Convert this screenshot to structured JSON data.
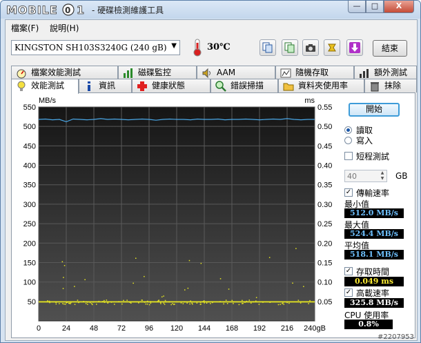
{
  "window": {
    "logo_text": "MOBILE01",
    "title": "- 硬碟檢測維護工具",
    "min_glyph": "—",
    "max_glyph": "□",
    "close_glyph": "X"
  },
  "menu": {
    "file": "檔案(F)",
    "help": "說明(H)"
  },
  "toolbar": {
    "drive": "KINGSTON SH103S3240G (240 gB)",
    "temperature": "30℃",
    "exit": "結束"
  },
  "tabs_top": [
    {
      "label": "檔案效能測試",
      "icon": "gauge-icon"
    },
    {
      "label": "磁碟監控",
      "icon": "bar-chart-icon"
    },
    {
      "label": "AAM",
      "icon": "speaker-icon"
    },
    {
      "label": "隨機存取",
      "icon": "random-access-icon"
    },
    {
      "label": "額外測試",
      "icon": "extra-chart-icon"
    }
  ],
  "tabs_bottom": [
    {
      "label": "效能測試",
      "icon": "bulb-icon"
    },
    {
      "label": "資訊",
      "icon": "info-icon"
    },
    {
      "label": "健康狀態",
      "icon": "red-cross-icon"
    },
    {
      "label": "錯誤掃描",
      "icon": "magnifier-icon"
    },
    {
      "label": "資料夾使用率",
      "icon": "folder-icon"
    },
    {
      "label": "抹除",
      "icon": "trash-icon"
    }
  ],
  "controls": {
    "start": "開始",
    "read": "讀取",
    "write": "寫入",
    "short_test": "短程測試",
    "size_value": "40",
    "size_unit": "GB",
    "transfer_rate": "傳輸速率",
    "min_label": "最小值",
    "min_value": "512.0 MB/s",
    "max_label": "最大值",
    "max_value": "524.4 MB/s",
    "avg_label": "平均值",
    "avg_value": "518.1 MB/s",
    "access_time": "存取時間",
    "access_value": "0.049 ms",
    "burst_rate": "高載速率",
    "burst_value": "325.8 MB/s",
    "cpu_label": "CPU 使用率",
    "cpu_value": "0.8%",
    "read_selected": true,
    "short_test_checked": false,
    "transfer_checked": true,
    "access_checked": true,
    "burst_checked": true
  },
  "chart_data": {
    "type": "line",
    "ylabel_left": "MB/s",
    "ylabel_right": "ms",
    "y_left_ticks": [
      "550",
      "500",
      "450",
      "400",
      "350",
      "300",
      "250",
      "200",
      "150",
      "100",
      "50"
    ],
    "y_right_ticks": [
      "0.55",
      "0.50",
      "0.45",
      "0.40",
      "0.35",
      "0.30",
      "0.25",
      "0.20",
      "0.15",
      "0.10",
      "0.05"
    ],
    "x_ticks": [
      "0",
      "24",
      "48",
      "72",
      "96",
      "120",
      "144",
      "168",
      "192",
      "216",
      "240gB"
    ],
    "ylim": [
      0,
      550
    ],
    "xlim": [
      0,
      240
    ],
    "grid": true,
    "series": [
      {
        "color": "#4aa8e8",
        "values_mbps": [
          518,
          519,
          517,
          518,
          512,
          519,
          518,
          517,
          518,
          520,
          518,
          519,
          518,
          517,
          518,
          519,
          518,
          516,
          518,
          519,
          518,
          518,
          517,
          519,
          518,
          518,
          519,
          517,
          518,
          518,
          519,
          518,
          517,
          518,
          519,
          518,
          520,
          518,
          517,
          518,
          518
        ]
      },
      {
        "color": "#e8e820",
        "access_ms_baseline": 0.049
      }
    ]
  },
  "watermark": "#2207953"
}
